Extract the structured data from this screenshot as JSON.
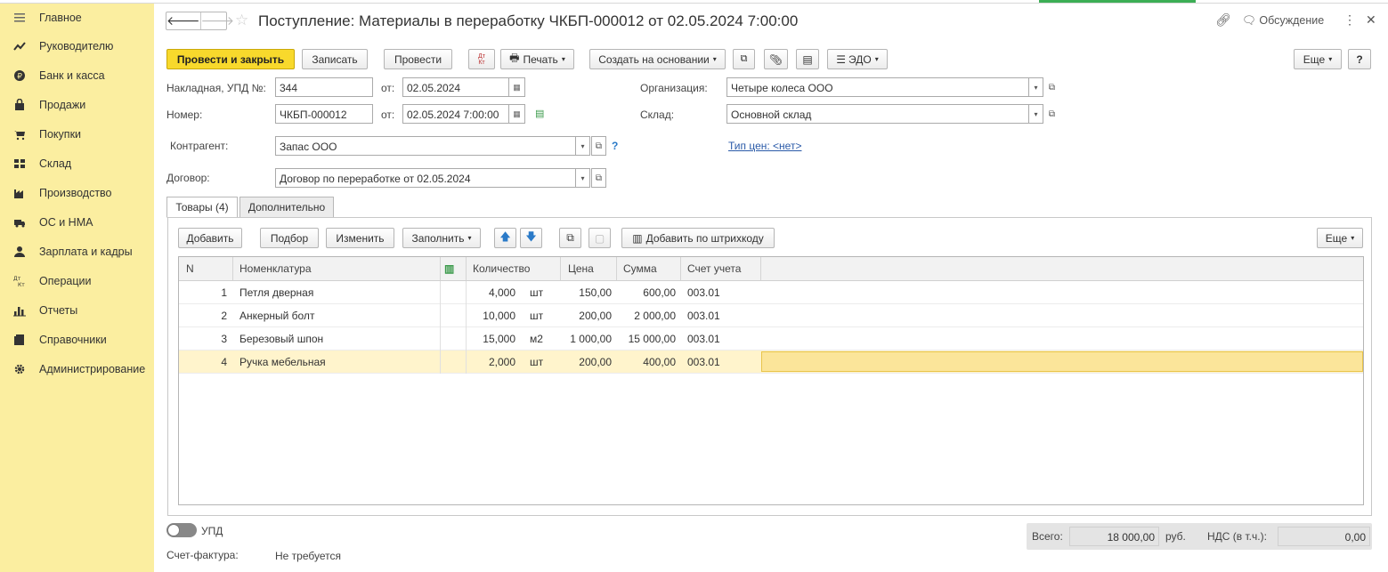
{
  "sidebar": {
    "items": [
      {
        "label": "Главное",
        "icon": "menu-icon"
      },
      {
        "label": "Руководителю",
        "icon": "trend-icon"
      },
      {
        "label": "Банк и касса",
        "icon": "ruble-icon"
      },
      {
        "label": "Продажи",
        "icon": "bag-icon"
      },
      {
        "label": "Покупки",
        "icon": "cart-icon"
      },
      {
        "label": "Склад",
        "icon": "warehouse-icon"
      },
      {
        "label": "Производство",
        "icon": "factory-icon"
      },
      {
        "label": "ОС и НМА",
        "icon": "truck-icon"
      },
      {
        "label": "Зарплата и кадры",
        "icon": "person-icon"
      },
      {
        "label": "Операции",
        "icon": "dt-kt-icon"
      },
      {
        "label": "Отчеты",
        "icon": "bar-chart-icon"
      },
      {
        "label": "Справочники",
        "icon": "book-icon"
      },
      {
        "label": "Администрирование",
        "icon": "gear-icon"
      }
    ]
  },
  "header": {
    "title": "Поступление: Материалы в переработку ЧКБП-000012 от 02.05.2024 7:00:00",
    "discussion": "Обсуждение"
  },
  "toolbar": {
    "post_close": "Провести и закрыть",
    "save": "Записать",
    "post": "Провести",
    "print": "Печать",
    "create_based": "Создать на основании",
    "edo": "ЭДО",
    "more": "Еще",
    "help": "?"
  },
  "form": {
    "invoice_label": "Накладная, УПД №:",
    "invoice_no": "344",
    "from_label": "от:",
    "invoice_date": "02.05.2024",
    "number_label": "Номер:",
    "number": "ЧКБП-000012",
    "number_date": "02.05.2024  7:00:00",
    "org_label": "Организация:",
    "org": "Четыре колеса ООО",
    "warehouse_label": "Склад:",
    "warehouse": "Основной склад",
    "counterparty_label": "Контрагент:",
    "counterparty": "Запас ООО",
    "price_type": "Тип цен: <нет>",
    "contract_label": "Договор:",
    "contract": "Договор по переработке от 02.05.2024"
  },
  "tabs": [
    {
      "label": "Товары (4)"
    },
    {
      "label": "Дополнительно"
    }
  ],
  "table_toolbar": {
    "add": "Добавить",
    "pick": "Подбор",
    "edit": "Изменить",
    "fill": "Заполнить",
    "barcode": "Добавить по штрихкоду",
    "more": "Еще"
  },
  "table": {
    "headers": [
      "N",
      "Номенклатура",
      "Количество",
      "Цена",
      "Сумма",
      "Счет учета"
    ],
    "rows": [
      {
        "n": "1",
        "name": "Петля дверная",
        "qty": "4,000",
        "unit": "шт",
        "price": "150,00",
        "sum": "600,00",
        "account": "003.01"
      },
      {
        "n": "2",
        "name": "Анкерный болт",
        "qty": "10,000",
        "unit": "шт",
        "price": "200,00",
        "sum": "2 000,00",
        "account": "003.01"
      },
      {
        "n": "3",
        "name": "Березовый шпон",
        "qty": "15,000",
        "unit": "м2",
        "price": "1 000,00",
        "sum": "15 000,00",
        "account": "003.01"
      },
      {
        "n": "4",
        "name": "Ручка мебельная",
        "qty": "2,000",
        "unit": "шт",
        "price": "200,00",
        "sum": "400,00",
        "account": "003.01"
      }
    ]
  },
  "footer": {
    "upd_label": "УПД",
    "invoice_label": "Счет-фактура:",
    "invoice_value": "Не требуется",
    "total_label": "Всего:",
    "total": "18 000,00",
    "currency": "руб.",
    "vat_label": "НДС (в т.ч.):",
    "vat": "0,00"
  }
}
